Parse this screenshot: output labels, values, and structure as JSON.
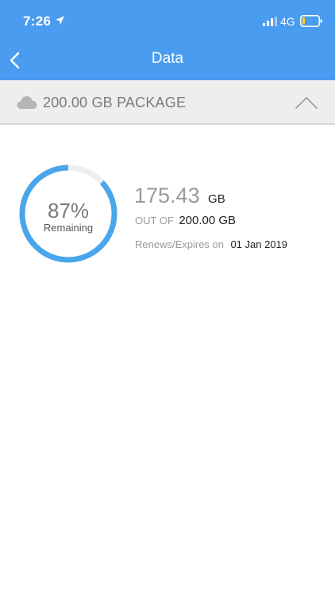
{
  "status_bar": {
    "time": "7:26",
    "network": "4G"
  },
  "nav": {
    "title": "Data",
    "back_icon": "chevron-left-icon"
  },
  "package": {
    "label": "200.00 GB PACKAGE",
    "icon": "cloud-icon",
    "toggle_icon": "chevron-up-icon"
  },
  "usage": {
    "percent_text": "87%",
    "remaining_fraction": 0.87,
    "caption": "Remaining",
    "remaining_value": "175.43",
    "remaining_unit": "GB",
    "total_prefix": "OUT OF",
    "total_value": "200.00 GB",
    "renew_prefix": "Renews/Expires on",
    "renew_date": "01 Jan 2019"
  },
  "colors": {
    "header": "#4a9cf0",
    "ring": "#4aa6ea",
    "ring_track": "#eeeeee",
    "battery_fill": "#f5d21e"
  }
}
